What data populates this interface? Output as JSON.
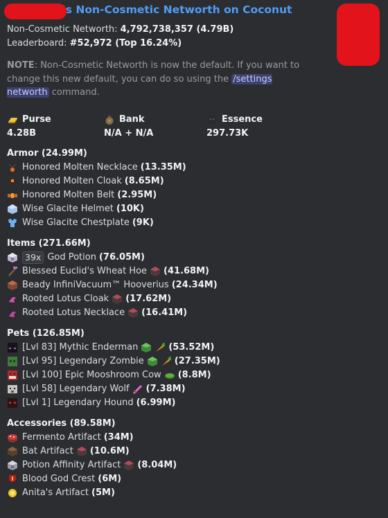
{
  "title": "'s Non-Cosmetic Networth on Coconut",
  "summary": {
    "networth_label": "Non-Cosmetic Networth:",
    "networth_value": "4,792,738,357 (4.79B)",
    "leaderboard_label": "Leaderboard:",
    "leaderboard_value": "#52,972 (Top 16.24%)"
  },
  "note": {
    "label": "NOTE",
    "text1": ": Non-Cosmetic Networth is now the default. If you want to change this new default, you can do so using the ",
    "command": "/settings networth",
    "text2": " command."
  },
  "stats": {
    "purse_label": "Purse",
    "purse_value": "4.28B",
    "bank_label": "Bank",
    "bank_value": "N/A + N/A",
    "essence_label": "Essence",
    "essence_value": "297.73K"
  },
  "armor": {
    "heading": "Armor (24.99M)",
    "items": [
      {
        "name": "Honored Molten Necklace",
        "value": "(13.35M)",
        "icon": "molten-necklace-icon"
      },
      {
        "name": "Honored Molten Cloak",
        "value": "(8.65M)",
        "icon": "molten-cloak-icon"
      },
      {
        "name": "Honored Molten Belt",
        "value": "(2.95M)",
        "icon": "molten-belt-icon"
      },
      {
        "name": "Wise Glacite Helmet",
        "value": "(10K)",
        "icon": "glacite-helmet-icon"
      },
      {
        "name": "Wise Glacite Chestplate",
        "value": "(9K)",
        "icon": "glacite-chestplate-icon"
      }
    ]
  },
  "items": {
    "heading": "Items (271.66M)",
    "list": [
      {
        "badge": "39x",
        "name": "God Potion",
        "value": "(76.05M)",
        "icon": "god-potion-icon"
      },
      {
        "name": "Blessed Euclid's Wheat Hoe",
        "value": "(41.68M)",
        "icon": "hoe-icon",
        "extra": "enchant-block-icon"
      },
      {
        "name": "Beady InfiniVacuum™ Hooverius",
        "value": "(24.34M)",
        "icon": "vacuum-icon"
      },
      {
        "name": "Rooted Lotus Cloak",
        "value": "(17.62M)",
        "icon": "lotus-cloak-icon",
        "extra": "enchant-block-icon"
      },
      {
        "name": "Rooted Lotus Necklace",
        "value": "(16.41M)",
        "icon": "lotus-necklace-icon",
        "extra": "enchant-block-icon"
      }
    ]
  },
  "pets": {
    "heading": "Pets (126.85M)",
    "list": [
      {
        "name": "[Lvl 83] Mythic Enderman",
        "value": "(53.52M)",
        "icon": "enderman-icon",
        "extras": [
          "slime-block-icon",
          "carrot-icon"
        ]
      },
      {
        "name": "[Lvl 95] Legendary Zombie",
        "value": "(27.35M)",
        "icon": "zombie-icon",
        "extras": [
          "slime-block-icon",
          "carrot-icon"
        ]
      },
      {
        "name": "[Lvl 100] Epic Mooshroom Cow",
        "value": "(8.8M)",
        "icon": "mooshroom-icon",
        "extras": [
          "lily-pad-icon"
        ]
      },
      {
        "name": "[Lvl 58] Legendary Wolf",
        "value": "(7.38M)",
        "icon": "wolf-icon",
        "extras": [
          "sword-icon"
        ]
      },
      {
        "name": "[Lvl 1] Legendary Hound",
        "value": "(6.99M)",
        "icon": "hound-icon",
        "extras": []
      }
    ]
  },
  "accessories": {
    "heading": "Accessories (89.58M)",
    "list": [
      {
        "name": "Fermento Artifact",
        "value": "(34M)",
        "icon": "fermento-icon"
      },
      {
        "name": "Bat Artifact",
        "value": "(10.6M)",
        "icon": "bat-artifact-icon",
        "extra": "enchant-block-icon"
      },
      {
        "name": "Potion Affinity Artifact",
        "value": "(8.04M)",
        "icon": "potion-affinity-icon",
        "extra": "enchant-block-icon"
      },
      {
        "name": "Blood God Crest",
        "value": "(6M)",
        "icon": "blood-god-crest-icon"
      },
      {
        "name": "Anita's Artifact",
        "value": "(5M)",
        "icon": "anita-artifact-icon"
      }
    ]
  }
}
